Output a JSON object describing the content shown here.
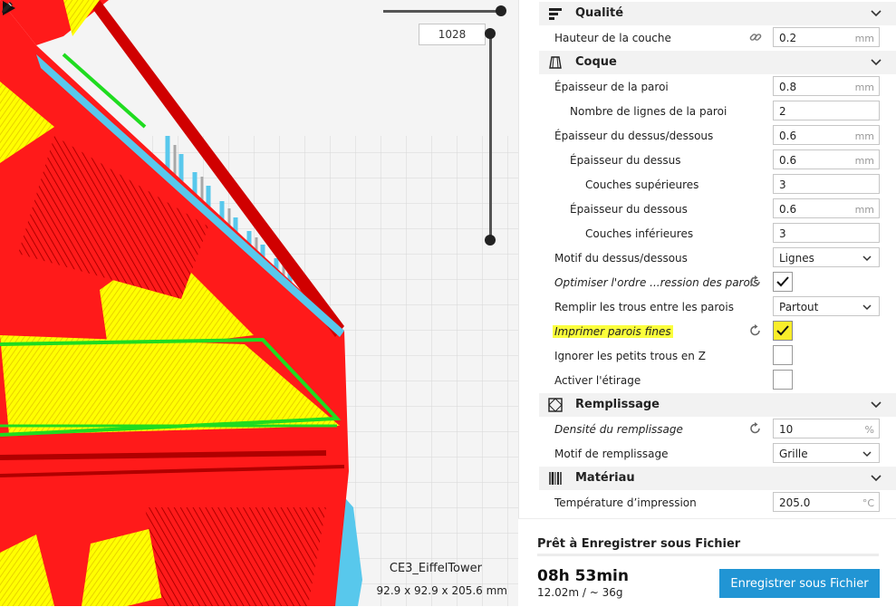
{
  "viewport": {
    "layer_number": "1028",
    "model_name": "CE3_EiffelTower",
    "model_dimensions": "92.9 x 92.9 x 205.6 mm"
  },
  "sections": {
    "quality": "Qualité",
    "shell": "Coque",
    "infill": "Remplissage",
    "material": "Matériau"
  },
  "settings": {
    "layer_height": {
      "label": "Hauteur de la couche",
      "value": "0.2",
      "unit": "mm"
    },
    "wall_thickness": {
      "label": "Épaisseur de la paroi",
      "value": "0.8",
      "unit": "mm"
    },
    "wall_line_count": {
      "label": "Nombre de lignes de la paroi",
      "value": "2"
    },
    "top_bottom_thickness": {
      "label": "Épaisseur du dessus/dessous",
      "value": "0.6",
      "unit": "mm"
    },
    "top_thickness": {
      "label": "Épaisseur du dessus",
      "value": "0.6",
      "unit": "mm"
    },
    "top_layers": {
      "label": "Couches supérieures",
      "value": "3"
    },
    "bottom_thickness": {
      "label": "Épaisseur du dessous",
      "value": "0.6",
      "unit": "mm"
    },
    "bottom_layers": {
      "label": "Couches inférieures",
      "value": "3"
    },
    "top_bottom_pattern": {
      "label": "Motif du dessus/dessous",
      "value": "Lignes"
    },
    "optimize_wall_order": {
      "label": "Optimiser l'ordre ...ression des parois",
      "checked": true
    },
    "fill_gaps": {
      "label": "Remplir les trous entre les parois",
      "value": "Partout"
    },
    "print_thin_walls": {
      "label": "Imprimer parois fines",
      "checked": true
    },
    "ignore_small_z_gaps": {
      "label": "Ignorer les petits trous en Z",
      "checked": false
    },
    "ironing": {
      "label": "Activer l'étirage",
      "checked": false
    },
    "infill_density": {
      "label": "Densité du remplissage",
      "value": "10",
      "unit": "%"
    },
    "infill_pattern": {
      "label": "Motif de remplissage",
      "value": "Grille"
    },
    "print_temperature": {
      "label": "Température d’impression",
      "value": "205.0",
      "unit": "°C"
    }
  },
  "footer": {
    "status": "Prêt à Enregistrer sous Fichier",
    "print_time": "08h 53min",
    "material_usage": "12.02m / ~ 36g",
    "save_button": "Enregistrer sous Fichier"
  },
  "colors": {
    "accent": "#2195d4",
    "highlight": "#fbff3c",
    "model_red": "#ff1a1a",
    "model_yellow": "#ffff00",
    "model_green": "#1fdc1f",
    "support_cyan": "#5ad2f0"
  },
  "icons": {
    "play": "play-icon",
    "edit": "pencil-icon",
    "link": "link-icon",
    "reset": "reset-icon"
  }
}
